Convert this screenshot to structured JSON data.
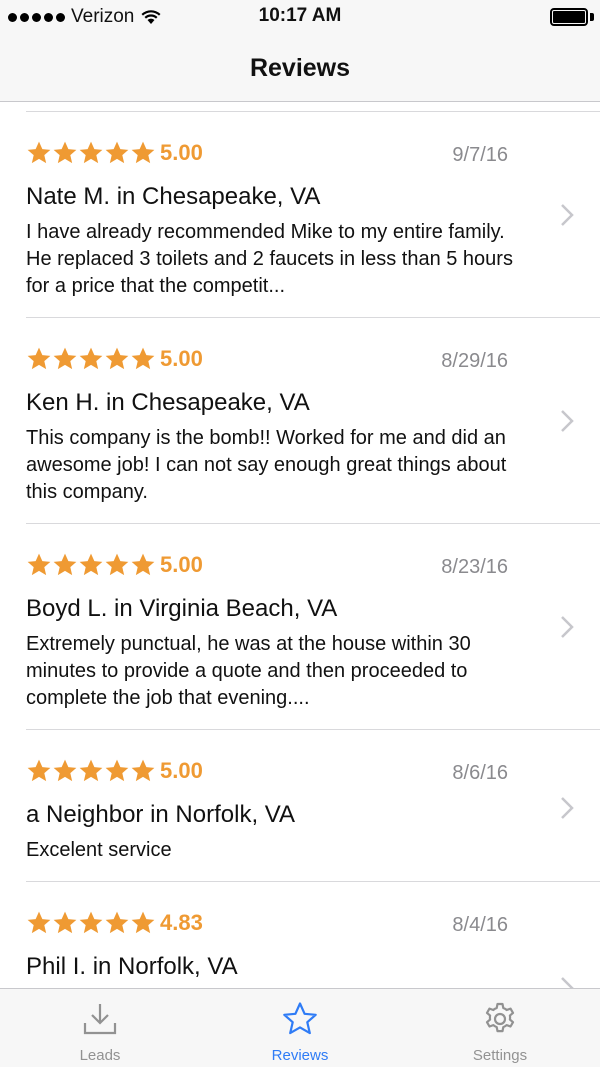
{
  "status_bar": {
    "carrier": "Verizon",
    "time": "10:17 AM"
  },
  "nav": {
    "title": "Reviews"
  },
  "colors": {
    "star": "#ef9a33",
    "accent": "#2f7cf6",
    "inactive": "#929292"
  },
  "reviews": [
    {
      "rating": "5.00",
      "date": "9/7/16",
      "author": "Nate M. in Chesapeake, VA",
      "text": "I have already recommended Mike to my entire family.  He replaced 3 toilets and 2 faucets in less than 5 hours for a price that the competit..."
    },
    {
      "rating": "5.00",
      "date": "8/29/16",
      "author": "Ken H. in Chesapeake, VA",
      "text": "This company is the bomb!! Worked for me and did an awesome job! I can not say enough great things about this company."
    },
    {
      "rating": "5.00",
      "date": "8/23/16",
      "author": "Boyd L. in Virginia Beach, VA",
      "text": "Extremely punctual, he was at the house within 30 minutes to provide a quote and then proceeded to complete the job that evening...."
    },
    {
      "rating": "5.00",
      "date": "8/6/16",
      "author": "a Neighbor in Norfolk, VA",
      "text": "Excelent service"
    },
    {
      "rating": "4.83",
      "date": "8/4/16",
      "author": "Phil I. in Norfolk, VA",
      "text": ""
    }
  ],
  "tabs": [
    {
      "label": "Leads",
      "icon": "download-tray-icon"
    },
    {
      "label": "Reviews",
      "icon": "star-outline-icon",
      "active": true
    },
    {
      "label": "Settings",
      "icon": "gear-icon"
    }
  ]
}
